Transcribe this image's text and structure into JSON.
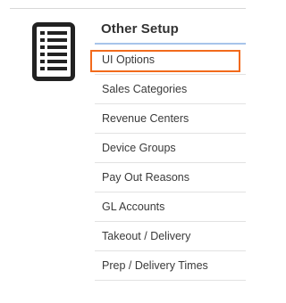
{
  "setup_icon": "list-document-icon",
  "section": {
    "title": "Other Setup"
  },
  "menu": {
    "items": [
      {
        "label": "UI Options",
        "highlighted": true
      },
      {
        "label": "Sales Categories"
      },
      {
        "label": "Revenue Centers"
      },
      {
        "label": "Device Groups"
      },
      {
        "label": "Pay Out Reasons"
      },
      {
        "label": "GL Accounts"
      },
      {
        "label": "Takeout / Delivery"
      },
      {
        "label": "Prep / Delivery Times"
      }
    ]
  },
  "colors": {
    "highlight": "#f26a1b",
    "underline_accent": "#a7c4ea",
    "text": "#3a3a3a"
  }
}
